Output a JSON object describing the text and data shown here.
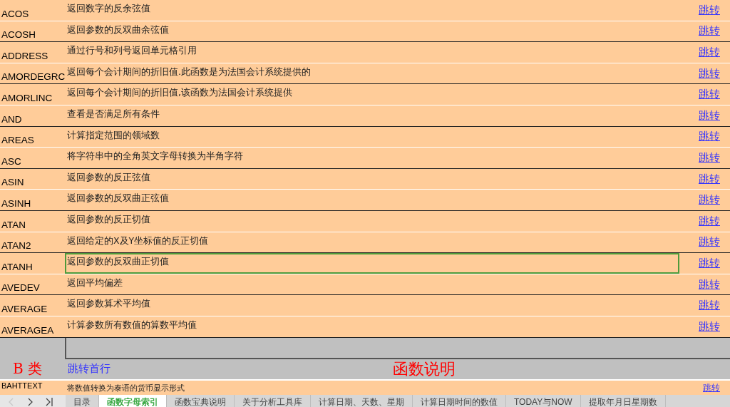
{
  "rows": [
    {
      "name": "ACOS",
      "description": "返回数字的反余弦值",
      "link": "跳转",
      "selected": false
    },
    {
      "name": "ACOSH",
      "description": "返回参数的反双曲余弦值",
      "link": "跳转",
      "selected": false
    },
    {
      "name": "ADDRESS",
      "description": "通过行号和列号返回单元格引用",
      "link": "跳转",
      "selected": false
    },
    {
      "name": "AMORDEGRC",
      "description": "返回每个会计期间的折旧值.此函数是为法国会计系统提供的",
      "link": "跳转",
      "selected": false
    },
    {
      "name": "AMORLINC",
      "description": "返回每个会计期间的折旧值,该函数为法国会计系统提供",
      "link": "跳转",
      "selected": false
    },
    {
      "name": "AND",
      "description": "查看是否满足所有条件",
      "link": "跳转",
      "selected": false
    },
    {
      "name": "AREAS",
      "description": "计算指定范围的领域数",
      "link": "跳转",
      "selected": false
    },
    {
      "name": "ASC",
      "description": "将字符串中的全角英文字母转换为半角字符",
      "link": "跳转",
      "selected": false
    },
    {
      "name": "ASIN",
      "description": "返回参数的反正弦值",
      "link": "跳转",
      "selected": false
    },
    {
      "name": "ASINH",
      "description": "返回参数的反双曲正弦值",
      "link": "跳转",
      "selected": false
    },
    {
      "name": "ATAN",
      "description": "返回参数的反正切值",
      "link": "跳转",
      "selected": false
    },
    {
      "name": "ATAN2",
      "description": "返回给定的X及Y坐标值的反正切值",
      "link": "跳转",
      "selected": false
    },
    {
      "name": "ATANH",
      "description": "返回参数的反双曲正切值",
      "link": "跳转",
      "selected": true
    },
    {
      "name": "AVEDEV",
      "description": "返回平均偏差",
      "link": "跳转",
      "selected": false
    },
    {
      "name": "AVERAGE",
      "description": "返回参数算术平均值",
      "link": "跳转",
      "selected": false
    },
    {
      "name": "AVERAGEA",
      "description": "计算参数所有数值的算数平均值",
      "link": "跳转",
      "selected": false
    }
  ],
  "section": {
    "category": "B 类",
    "top_link": "跳转首行",
    "heading": "函数说明"
  },
  "next_row": {
    "name": "BAHTTEXT",
    "description": "将数值转换为泰语的货币显示形式",
    "link": "跳转"
  },
  "sheet_tabs": [
    {
      "label": "目录",
      "selected": false
    },
    {
      "label": "函数字母索引",
      "selected": true
    },
    {
      "label": "函数宝典说明",
      "selected": false
    },
    {
      "label": "关于分析工具库",
      "selected": false
    },
    {
      "label": "计算日期、天数、星期",
      "selected": false
    },
    {
      "label": "计算日期时间的数值",
      "selected": false
    },
    {
      "label": "TODAY与NOW",
      "selected": false
    },
    {
      "label": "提取年月日星期数",
      "selected": false
    }
  ]
}
